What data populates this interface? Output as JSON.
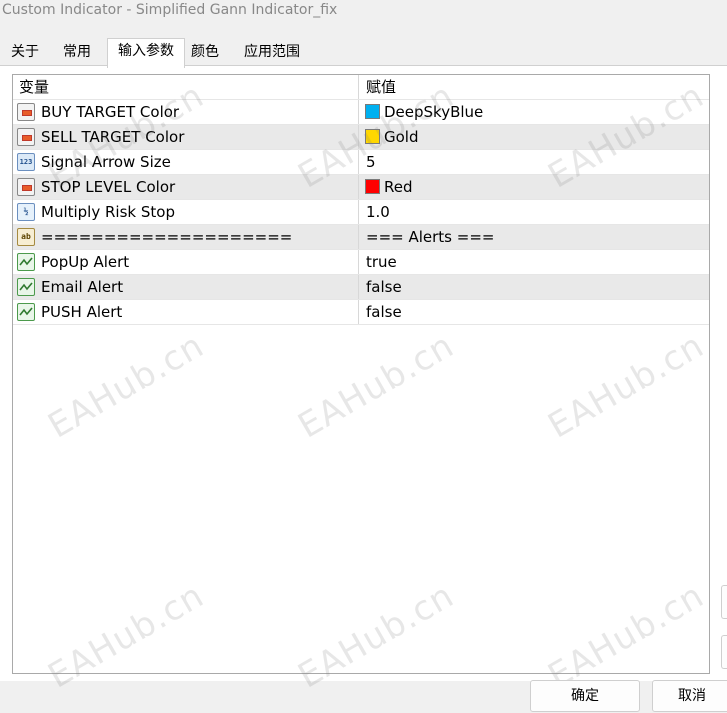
{
  "window": {
    "title": "Custom Indicator - Simplified Gann Indicator_fix"
  },
  "tabs": [
    {
      "label": "关于",
      "active": false
    },
    {
      "label": "常用",
      "active": false
    },
    {
      "label": "输入参数",
      "active": true
    },
    {
      "label": "颜色",
      "active": false
    },
    {
      "label": "应用范围",
      "active": false
    }
  ],
  "grid": {
    "headers": {
      "variable": "变量",
      "value": "赋值"
    },
    "rows": [
      {
        "name": "BUY TARGET Color",
        "value": "DeepSkyBlue",
        "type": "color",
        "swatch": "#00b0f0"
      },
      {
        "name": "SELL TARGET Color",
        "value": "Gold",
        "type": "color",
        "swatch": "#ffd700"
      },
      {
        "name": "Signal Arrow Size",
        "value": "5",
        "type": "int"
      },
      {
        "name": "STOP LEVEL Color",
        "value": "Red",
        "type": "color",
        "swatch": "#ff0000"
      },
      {
        "name": "Multiply Risk Stop",
        "value": "1.0",
        "type": "double"
      },
      {
        "name": "====================",
        "value": "=== Alerts ===",
        "type": "string"
      },
      {
        "name": "PopUp Alert",
        "value": "true",
        "type": "bool"
      },
      {
        "name": "Email Alert",
        "value": "false",
        "type": "bool"
      },
      {
        "name": "PUSH Alert",
        "value": "false",
        "type": "bool"
      }
    ]
  },
  "icons": {
    "int": "123",
    "double": "½",
    "string": "ab"
  },
  "buttons": {
    "ok": "确定",
    "cancel": "取消"
  },
  "watermark": "EAHub.cn"
}
